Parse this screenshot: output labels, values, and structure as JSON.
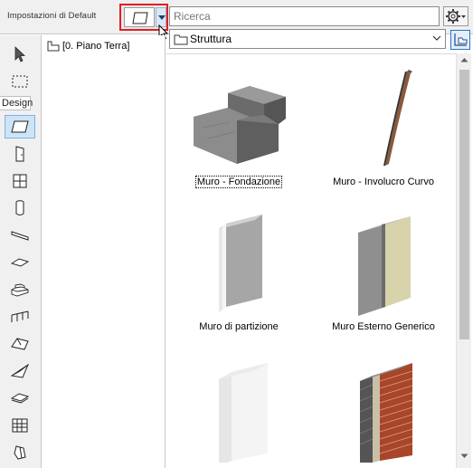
{
  "header": {
    "defaults_label": "Impostazioni di Default",
    "search_placeholder": "Ricerca"
  },
  "tree": {
    "item_label": "[0. Piano Terra]"
  },
  "toolbar": {
    "design_tab": "Design"
  },
  "library": {
    "folder": "Struttura",
    "items": [
      {
        "label": "Muro - Fondazione",
        "selected": true
      },
      {
        "label": "Muro - Involucro Curvo",
        "selected": false
      },
      {
        "label": "Muro di partizione",
        "selected": false
      },
      {
        "label": "Muro Esterno Generico",
        "selected": false
      },
      {
        "label": "",
        "selected": false
      },
      {
        "label": "",
        "selected": false
      }
    ]
  },
  "colors": {
    "highlight_border": "#e02020",
    "selection_blue": "#cde4f7",
    "accent_blue": "#2d72c4"
  }
}
